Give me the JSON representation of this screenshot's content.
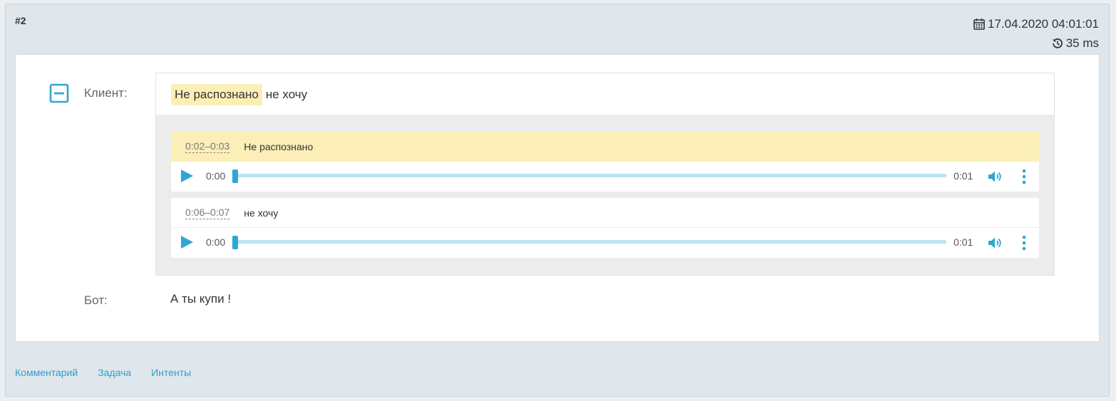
{
  "record": {
    "id": "#2",
    "datetime": "17.04.2020 04:01:01",
    "duration": "35 ms"
  },
  "client": {
    "label": "Клиент:",
    "highlighted": "Не распознано",
    "text": "не хочу"
  },
  "segments": [
    {
      "time_range": "0:02–0:03",
      "text": "Не распознано",
      "player": {
        "current": "0:00",
        "duration": "0:01",
        "progress": 0
      }
    },
    {
      "time_range": "0:06–0:07",
      "text": "не хочу",
      "player": {
        "current": "0:00",
        "duration": "0:01",
        "progress": 0
      }
    }
  ],
  "bot": {
    "label": "Бот:",
    "text": "А ты купи !"
  },
  "footer": {
    "comment": "Комментарий",
    "task": "Задача",
    "intents": "Интенты"
  },
  "icons": {
    "date": "calendar-icon",
    "duration": "history-icon",
    "collapse": "minus-square-icon",
    "play": "play-icon",
    "volume": "volume-icon",
    "menu": "more-vertical-icon"
  },
  "colors": {
    "accent": "#2ea7d3",
    "highlight": "#fbefb7",
    "link": "#2b9fd0"
  }
}
